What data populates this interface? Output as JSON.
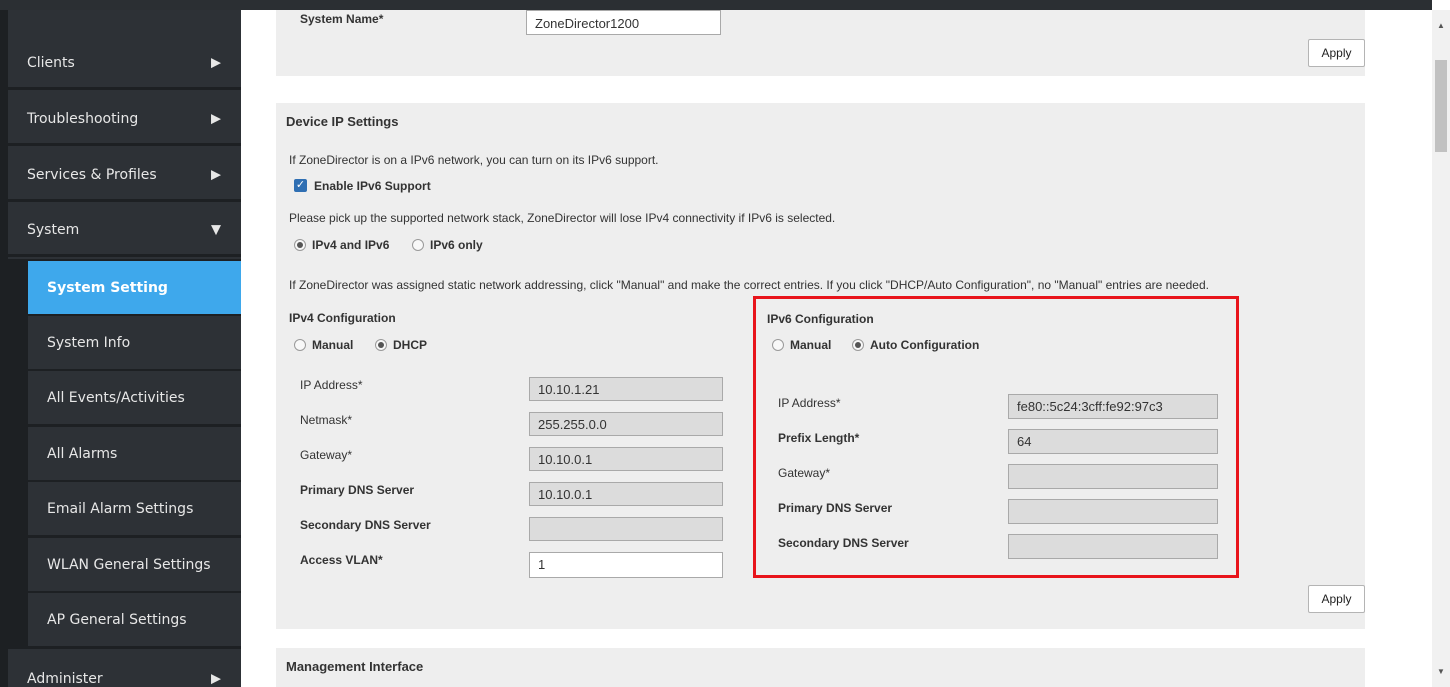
{
  "sidebar": {
    "items": [
      {
        "label": "Clients",
        "arrow": "▶"
      },
      {
        "label": "Troubleshooting",
        "arrow": "▶"
      },
      {
        "label": "Services & Profiles",
        "arrow": "▶"
      },
      {
        "label": "System",
        "arrow": "▼"
      },
      {
        "label": "Administer",
        "arrow": "▶"
      }
    ],
    "sub_items": [
      {
        "label": "System Setting",
        "active": true
      },
      {
        "label": "System Info"
      },
      {
        "label": "All Events/Activities"
      },
      {
        "label": "All Alarms"
      },
      {
        "label": "Email Alarm Settings"
      },
      {
        "label": "WLAN General Settings"
      },
      {
        "label": "AP General Settings"
      }
    ]
  },
  "system_name": {
    "label": "System Name*",
    "value": "ZoneDirector1200",
    "apply": "Apply"
  },
  "device_ip": {
    "title": "Device IP Settings",
    "ipv6_note": "If ZoneDirector is on a IPv6 network, you can turn on its IPv6 support.",
    "enable_ipv6_label": "Enable IPv6 Support",
    "stack_note": "Please pick up the supported network stack, ZoneDirector will lose IPv4 connectivity if IPv6 is selected.",
    "stack_options": [
      "IPv4 and IPv6",
      "IPv6 only"
    ],
    "static_note": "If ZoneDirector was assigned static network addressing, click \"Manual\" and make the correct entries. If you click \"DHCP/Auto Configuration\", no \"Manual\" entries are needed.",
    "ipv4": {
      "title": "IPv4 Configuration",
      "mode_options": [
        "Manual",
        "DHCP"
      ],
      "fields": [
        {
          "label": "IP Address*",
          "value": "10.10.1.21"
        },
        {
          "label": "Netmask*",
          "value": "255.255.0.0"
        },
        {
          "label": "Gateway*",
          "value": "10.10.0.1"
        },
        {
          "label": "Primary DNS Server",
          "value": "10.10.0.1"
        },
        {
          "label": "Secondary DNS Server",
          "value": ""
        },
        {
          "label": "Access VLAN*",
          "value": "1"
        }
      ]
    },
    "ipv6": {
      "title": "IPv6 Configuration",
      "mode_options": [
        "Manual",
        "Auto Configuration"
      ],
      "fields": [
        {
          "label": "IP Address*",
          "value": "fe80::5c24:3cff:fe92:97c3"
        },
        {
          "label": "Prefix Length*",
          "value": "64"
        },
        {
          "label": "Gateway*",
          "value": ""
        },
        {
          "label": "Primary DNS Server",
          "value": ""
        },
        {
          "label": "Secondary DNS Server",
          "value": ""
        }
      ]
    },
    "apply": "Apply"
  },
  "management_interface": {
    "title": "Management Interface"
  },
  "colors": {
    "sidebar_bg": "#2d3136",
    "active_item": "#3ea8ec",
    "highlight_box": "#e8141b"
  }
}
